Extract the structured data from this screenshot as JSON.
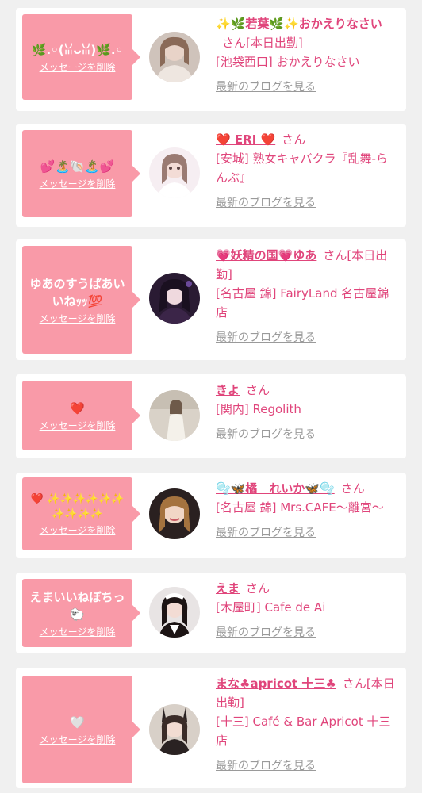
{
  "delete_label": "メッセージを削除",
  "honorific": "さん",
  "blog_link": "最新のブログを見る",
  "colors": {
    "bubble": "#f99aa8",
    "accent": "#e0457b",
    "muted": "#9a9a9a",
    "card": "#ffffff",
    "page_bg": "#f0f0f0"
  },
  "items": [
    {
      "message": "🌿.◦(ꈍᴗꈍ)🌿.◦",
      "name": "✨🌿若葉🌿✨おかえりなさい",
      "status": "[本日出勤]",
      "shop": "[池袋西口] おかえりなさい",
      "avatar_icon": "profile-photo"
    },
    {
      "message": "💕🏝️🐚🏝️💕",
      "name": "❤️ ERI ❤️",
      "status": "",
      "shop": "[安城] 熟女キャバクラ『乱舞-らんぶ』",
      "avatar_icon": "profile-photo"
    },
    {
      "message": "ゆあのすうぱあいいねｯｯ💯",
      "name": "💗妖精の国💗ゆあ",
      "status": "[本日出勤]",
      "shop": "[名古屋 錦] FairyLand 名古屋錦店",
      "avatar_icon": "profile-photo"
    },
    {
      "message": "❤️",
      "name": "きよ",
      "status": "",
      "shop": "[関内] Regolith",
      "avatar_icon": "profile-photo"
    },
    {
      "message": "❤️ ✨✨✨✨✨✨ ✨✨✨✨",
      "name": "🫧🦋橘　れいか🦋🫧",
      "status": "",
      "shop": "[名古屋 錦] Mrs.CAFE〜離宮〜",
      "avatar_icon": "profile-photo"
    },
    {
      "message": "えまいいねぼちっ🐑",
      "name": "えま",
      "status": "",
      "shop": "[木屋町] Cafe de Ai",
      "avatar_icon": "profile-photo"
    },
    {
      "message": "🤍",
      "name": "まな♣apricot 十三♣",
      "status": "[本日出勤]",
      "shop": "[十三] Café & Bar Apricot 十三店",
      "avatar_icon": "profile-photo"
    }
  ]
}
